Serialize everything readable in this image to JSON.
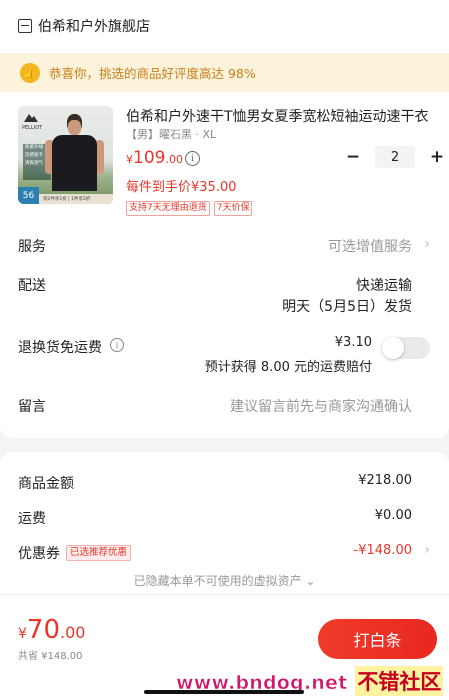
{
  "store": {
    "name": "伯希和户外旗舰店",
    "icon": "store-icon"
  },
  "praise_banner": {
    "text": "恭喜你，挑选的商品好评度高达 98%",
    "icon": "thumbs-up-icon",
    "color": "#c9801a"
  },
  "product": {
    "title": "伯希和户外速干T恤男女夏季宽松短袖运动速干衣",
    "spec": "【男】曜石黑 · XL",
    "price_symbol": "¥",
    "price_int": "109",
    "price_dec": ".00",
    "final_price": "每件到手价¥35.00",
    "tags": [
      "支持7天无理由退货",
      "7天价保"
    ],
    "quantity": "2",
    "image": {
      "brand": "PELLIOT",
      "lines": [
        "防紫外线",
        "凉感速干",
        "清爽透气"
      ],
      "badge": "56",
      "strip": "到2件享1折 | 1件享2折"
    }
  },
  "rows": {
    "service_label": "服务",
    "service_value": "可选增值服务",
    "delivery_label": "配送",
    "delivery_value1": "快递运输",
    "delivery_value2": "明天（5月5日）发货",
    "return_label": "退换货免运费",
    "return_value1": "¥3.10",
    "return_value2": "预计获得 8.00 元的运费赔付",
    "message_label": "留言",
    "message_placeholder": "建议留言前先与商家沟通确认"
  },
  "summary": {
    "goods_label": "商品金额",
    "goods_value": "¥218.00",
    "shipping_label": "运费",
    "shipping_value": "¥0.00",
    "coupon_label": "优惠券",
    "coupon_badge": "已选推荐优惠",
    "coupon_value": "-¥148.00",
    "hidden_note": "已隐藏本单不可使用的虚拟资产 ⌄"
  },
  "footer": {
    "total_symbol": "¥",
    "total_int": "70",
    "total_dec": ".00",
    "saved": "共省 ¥148.00",
    "pay_label": "打白条"
  },
  "watermark": {
    "url": "www.bndog.net",
    "cn": "不错社区"
  },
  "colors": {
    "accent": "#e8362a",
    "banner_bg": "#fdf2dc"
  }
}
